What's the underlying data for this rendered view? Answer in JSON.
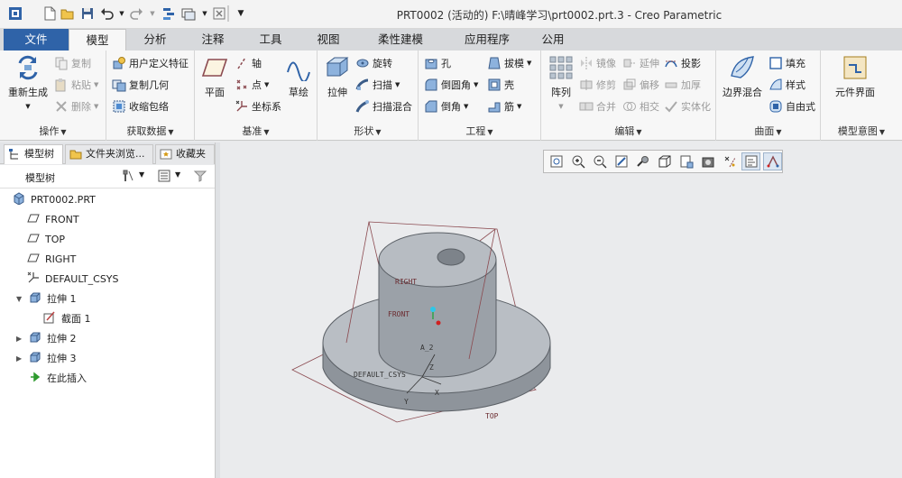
{
  "window": {
    "title": "PRT0002 (活动的) F:\\晴峰学习\\prt0002.prt.3 - Creo Parametric"
  },
  "quick_access": [
    "new-icon",
    "open-icon",
    "save-icon",
    "undo-icon",
    "redo-icon",
    "regenerate-icon",
    "window-icon",
    "close-window-icon",
    "customize-icon"
  ],
  "tabs": [
    "文件",
    "模型",
    "分析",
    "注释",
    "工具",
    "视图",
    "柔性建模",
    "应用程序",
    "公用"
  ],
  "ribbon": {
    "operations": {
      "label": "操作",
      "regenerate": "重新生成",
      "copy": "复制",
      "paste": "粘贴",
      "delete": "删除"
    },
    "get_data": {
      "label": "获取数据",
      "udf": "用户定义特征",
      "copy_geom": "复制几何",
      "shrinkwrap": "收缩包络"
    },
    "datum": {
      "label": "基准",
      "plane": "平面",
      "axis": "轴",
      "point": "点",
      "csys": "坐标系",
      "sketch": "草绘"
    },
    "shapes": {
      "label": "形状",
      "extrude": "拉伸",
      "revolve": "旋转",
      "sweep": "扫描",
      "swept_blend": "扫描混合"
    },
    "engineering": {
      "label": "工程",
      "hole": "孔",
      "round": "倒圆角",
      "chamfer": "倒角",
      "draft": "拔模",
      "shell": "壳",
      "rib": "筋"
    },
    "editing": {
      "label": "编辑",
      "pattern": "阵列",
      "mirror": "镜像",
      "trim": "修剪",
      "merge": "合并",
      "extend": "延伸",
      "offset": "偏移",
      "intersect": "相交",
      "project": "投影",
      "thicken": "加厚",
      "solidify": "实体化"
    },
    "surfaces": {
      "label": "曲面",
      "boundary_blend": "边界混合",
      "fill": "填充",
      "style": "样式",
      "freestyle": "自由式"
    },
    "model_intent": {
      "label": "模型意图",
      "component_interface": "元件界面"
    }
  },
  "left_panel": {
    "tabs": [
      "模型树",
      "文件夹浏览...",
      "收藏夹"
    ],
    "tree_title": "模型树",
    "tree": [
      {
        "label": "PRT0002.PRT",
        "icon": "part-icon"
      },
      {
        "label": "FRONT",
        "icon": "datum-plane-icon"
      },
      {
        "label": "TOP",
        "icon": "datum-plane-icon"
      },
      {
        "label": "RIGHT",
        "icon": "datum-plane-icon"
      },
      {
        "label": "DEFAULT_CSYS",
        "icon": "csys-icon"
      },
      {
        "label": "拉伸 1",
        "icon": "extrude-icon"
      },
      {
        "label": "截面 1",
        "icon": "sketch-icon"
      },
      {
        "label": "拉伸 2",
        "icon": "extrude-icon"
      },
      {
        "label": "拉伸 3",
        "icon": "extrude-icon"
      },
      {
        "label": "在此插入",
        "icon": "insert-here-icon"
      }
    ]
  },
  "graphics": {
    "toolbar": [
      "refit-icon",
      "zoom-in-icon",
      "zoom-out-icon",
      "repaint-icon",
      "spin-center-icon",
      "display-style-icon",
      "saved-views-icon",
      "view-manager-icon",
      "datum-display-icon",
      "annotation-display-icon",
      "plane-tag-icon"
    ],
    "labels": {
      "right": "RIGHT",
      "front": "FRONT",
      "top": "TOP",
      "csys": "DEFAULT_CSYS",
      "a2": "A_2",
      "x": "X",
      "y": "Y",
      "z": "Z"
    }
  },
  "colors": {
    "file_tab": "#2f63a8",
    "datum": "#8b4a50",
    "model": "#8e949b"
  }
}
